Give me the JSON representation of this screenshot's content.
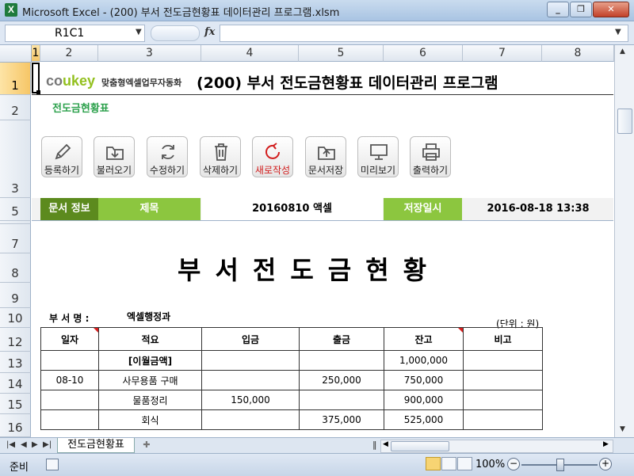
{
  "window": {
    "title": "Microsoft Excel - (200) 부서 전도금현황표 데이터관리 프로그램.xlsm",
    "app_icon": "X",
    "buttons": [
      "minimize",
      "restore",
      "close"
    ]
  },
  "formula_bar": {
    "name_box": "R1C1",
    "fx": "fx",
    "formula": ""
  },
  "columns": [
    "1",
    "2",
    "3",
    "4",
    "5",
    "6",
    "7",
    "8"
  ],
  "rows": [
    "1",
    "2",
    "3",
    "5",
    "7",
    "8",
    "9",
    "10",
    "12",
    "13",
    "14",
    "15",
    "16"
  ],
  "header": {
    "brand_co": "co",
    "brand_ukey": "ukey",
    "tagline": "맞춤형엑셀업무자동화",
    "title": "(200) 부서 전도금현황표 데이터관리 프로그램",
    "subtitle": "전도금현황표"
  },
  "toolbar": [
    {
      "label": "등록하기",
      "icon": "pencil-icon"
    },
    {
      "label": "불러오기",
      "icon": "folder-download-icon"
    },
    {
      "label": "수정하기",
      "icon": "refresh-icon"
    },
    {
      "label": "삭제하기",
      "icon": "trash-icon"
    },
    {
      "label": "새로작성",
      "icon": "new-document-icon"
    },
    {
      "label": "문서저장",
      "icon": "folder-upload-icon"
    },
    {
      "label": "미리보기",
      "icon": "monitor-icon"
    },
    {
      "label": "출력하기",
      "icon": "printer-icon"
    }
  ],
  "doc_info": {
    "label": "문서 정보",
    "title_label": "제목",
    "title_value": "20160810 액셀",
    "saved_label": "저장일시",
    "saved_value": "2016-08-18 13:38"
  },
  "doc": {
    "title": "부서전도금현황",
    "dept_label": "부 서 명 :",
    "dept_value": "엑셀행정과",
    "unit": "(단위 : 원)"
  },
  "table": {
    "headers": [
      "일자",
      "적요",
      "입금",
      "출금",
      "잔고",
      "비고"
    ],
    "rows": [
      [
        "",
        "[이월금액]",
        "",
        "",
        "1,000,000",
        ""
      ],
      [
        "08-10",
        "사무용품 구매",
        "",
        "250,000",
        "750,000",
        ""
      ],
      [
        "",
        "물품정리",
        "150,000",
        "",
        "900,000",
        ""
      ],
      [
        "",
        "회식",
        "",
        "375,000",
        "525,000",
        ""
      ]
    ]
  },
  "sheet_tab": "전도금현황표",
  "status": {
    "ready": "준비",
    "zoom": "100%"
  },
  "colors": {
    "green_dark": "#5c8a1e",
    "green_light": "#8cc63f",
    "brand_green": "#93c01f",
    "selection": "#f6c667"
  }
}
